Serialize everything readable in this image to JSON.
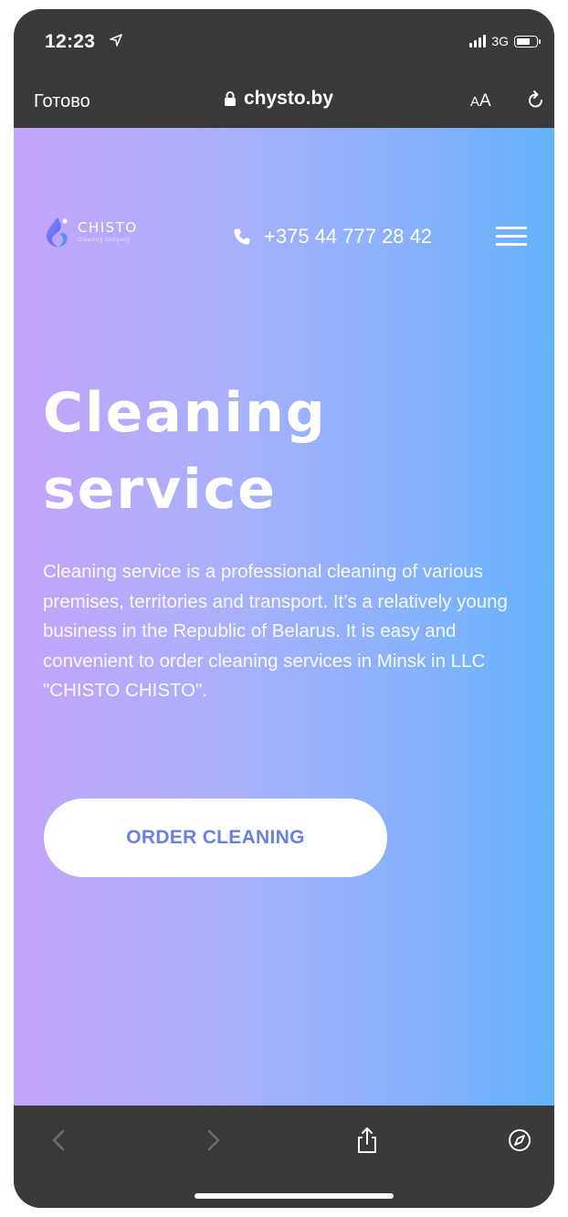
{
  "status_bar": {
    "time": "12:23",
    "network": "3G",
    "icons": [
      "location-arrow-icon",
      "signal-icon",
      "battery-icon"
    ]
  },
  "browser_bar": {
    "done_label": "Готово",
    "url": "chysto.by",
    "text_size_label_small": "A",
    "text_size_label_large": "A",
    "icons": [
      "lock-icon",
      "reload-icon"
    ]
  },
  "site": {
    "logo_name": "CHISTO",
    "logo_subtitle": "Cleaning company",
    "phone": "+375 44 777 28 42",
    "hero_title_line1": "Cleaning",
    "hero_title_line2": "service",
    "hero_text": "Cleaning service is a professional cleaning of various premises, territories and transport. It’s a relatively young business in the Republic of Belarus. It is easy and convenient to order cleaning services in Minsk in LLC \"CHISTO CHISTO\".",
    "order_button": "ORDER CLEANING",
    "colors": {
      "gradient_start": "#c3a4fb",
      "gradient_end": "#63b3fb",
      "button_text": "#6a7fe6"
    }
  },
  "toolbar": {
    "icons": [
      "back-icon",
      "forward-icon",
      "share-icon",
      "compass-icon"
    ]
  }
}
